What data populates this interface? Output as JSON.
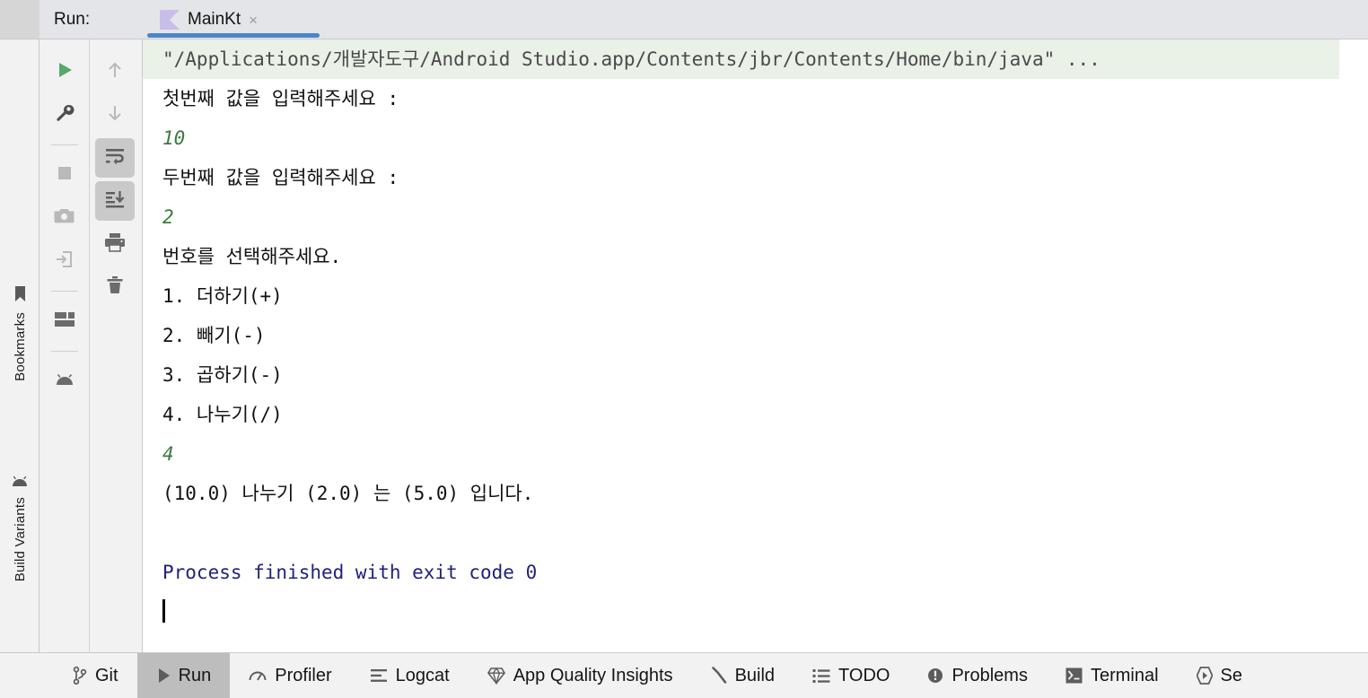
{
  "window": {
    "run_label": "Run:",
    "tab": {
      "title": "MainKt",
      "close": "×",
      "icon": "kotlin-file-icon"
    },
    "accent_underline": "#4a86c8"
  },
  "left_strip": {
    "items": [
      {
        "label": "Bookmarks",
        "icon": "bookmark-icon"
      },
      {
        "label": "Build Variants",
        "icon": "android-icon"
      }
    ]
  },
  "run_toolbar": {
    "column_a": [
      {
        "name": "rerun-button",
        "icon": "play-icon",
        "pressed": false
      },
      {
        "name": "edit-configurations-button",
        "icon": "wrench-icon",
        "pressed": false
      },
      {
        "name": "stop-button",
        "icon": "stop-square-icon",
        "pressed": false
      },
      {
        "name": "screenshot-button",
        "icon": "camera-icon",
        "pressed": false
      },
      {
        "name": "dump-threads-button",
        "icon": "import-arrow-icon",
        "pressed": false
      },
      {
        "name": "layout-inspector-button",
        "icon": "layout-icon",
        "pressed": false
      },
      {
        "name": "android-button",
        "icon": "android-icon",
        "pressed": false
      }
    ],
    "column_b": [
      {
        "name": "previous-occurrence-button",
        "icon": "arrow-up-icon",
        "pressed": false
      },
      {
        "name": "next-occurrence-button",
        "icon": "arrow-down-icon",
        "pressed": false
      },
      {
        "name": "soft-wrap-button",
        "icon": "soft-wrap-icon",
        "pressed": true
      },
      {
        "name": "scroll-to-end-button",
        "icon": "scroll-to-end-icon",
        "pressed": true
      },
      {
        "name": "print-button",
        "icon": "printer-icon",
        "pressed": false
      },
      {
        "name": "clear-all-button",
        "icon": "trash-icon",
        "pressed": false
      }
    ]
  },
  "console": {
    "lines": [
      {
        "text": "\"/Applications/개발자도구/Android Studio.app/Contents/jbr/Contents/Home/bin/java\" ...",
        "style": "cmd"
      },
      {
        "text": "첫번째 값을 입력해주세요 :",
        "style": "out"
      },
      {
        "text": "10",
        "style": "stdin"
      },
      {
        "text": "두번째 값을 입력해주세요 :",
        "style": "out"
      },
      {
        "text": "2",
        "style": "stdin"
      },
      {
        "text": "번호를 선택해주세요.",
        "style": "out"
      },
      {
        "text": "1. 더하기(+)",
        "style": "out"
      },
      {
        "text": "2. 빼기(-)",
        "style": "out"
      },
      {
        "text": "3. 곱하기(-)",
        "style": "out"
      },
      {
        "text": "4. 나누기(/)",
        "style": "out"
      },
      {
        "text": "4",
        "style": "stdin"
      },
      {
        "text": "(10.0) 나누기 (2.0) 는 (5.0) 입니다.",
        "style": "out"
      },
      {
        "text": "",
        "style": "blank"
      },
      {
        "text": "Process finished with exit code 0",
        "style": "finish"
      }
    ],
    "caret_visible": true,
    "colors": {
      "command_background": "#eaf1e7",
      "stdin_text": "#397a3a",
      "process_finished_text": "#20227a",
      "stdout_text": "#111111"
    }
  },
  "statusbar": {
    "items": [
      {
        "label": "Git",
        "icon": "git-branch-icon",
        "active": false
      },
      {
        "label": "Run",
        "icon": "play-icon",
        "active": true
      },
      {
        "label": "Profiler",
        "icon": "profiler-icon",
        "active": false
      },
      {
        "label": "Logcat",
        "icon": "logcat-lines-icon",
        "active": false
      },
      {
        "label": "App Quality Insights",
        "icon": "diamond-icon",
        "active": false
      },
      {
        "label": "Build",
        "icon": "hammer-icon",
        "active": false
      },
      {
        "label": "TODO",
        "icon": "checklist-icon",
        "active": false
      },
      {
        "label": "Problems",
        "icon": "exclamation-circle-icon",
        "active": false
      },
      {
        "label": "Terminal",
        "icon": "terminal-icon",
        "active": false
      },
      {
        "label": "Se",
        "icon": "services-icon",
        "active": false
      }
    ]
  }
}
